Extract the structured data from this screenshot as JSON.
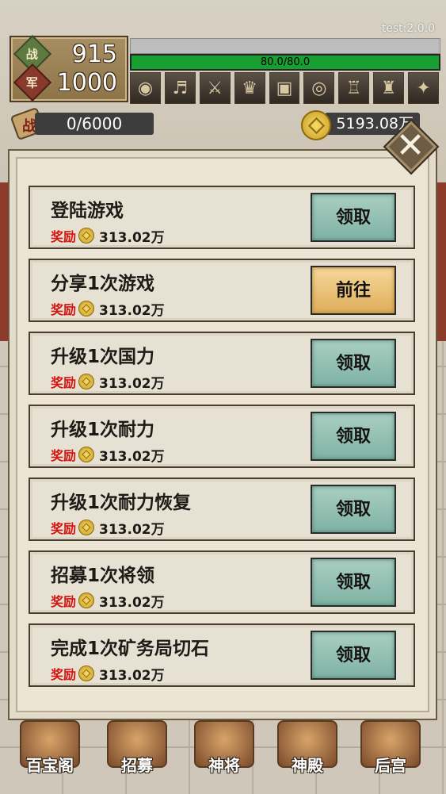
{
  "version_label": "test:2.0.0",
  "hud": {
    "stat1": {
      "icon_char": "战",
      "value": "915"
    },
    "stat2": {
      "icon_char": "军",
      "value": "1000"
    },
    "hp": {
      "text": "80.0/80.0",
      "fraction": 1.0
    },
    "equip_icons": [
      "orb-icon",
      "guitar-icon",
      "crossbow-icon",
      "golden-dragon-icon",
      "treasure-box-icon",
      "drum-icon",
      "chalice-icon",
      "golden-pagoda-icon",
      "sword-icon"
    ],
    "scroll_char": "战",
    "progress_text": "0/6000",
    "gold_text": "5193.08万"
  },
  "modal": {
    "close_label": "✕",
    "tasks": [
      {
        "title": "登陆游戏",
        "reward_label": "奖励",
        "amount": "313.02万",
        "button": "领取",
        "type": "claim"
      },
      {
        "title": "分享1次游戏",
        "reward_label": "奖励",
        "amount": "313.02万",
        "button": "前往",
        "type": "go"
      },
      {
        "title": "升级1次国力",
        "reward_label": "奖励",
        "amount": "313.02万",
        "button": "领取",
        "type": "claim"
      },
      {
        "title": "升级1次耐力",
        "reward_label": "奖励",
        "amount": "313.02万",
        "button": "领取",
        "type": "claim"
      },
      {
        "title": "升级1次耐力恢复",
        "reward_label": "奖励",
        "amount": "313.02万",
        "button": "领取",
        "type": "claim"
      },
      {
        "title": "招募1次将领",
        "reward_label": "奖励",
        "amount": "313.02万",
        "button": "领取",
        "type": "claim"
      },
      {
        "title": "完成1次矿务局切石",
        "reward_label": "奖励",
        "amount": "313.02万",
        "button": "领取",
        "type": "claim"
      }
    ]
  },
  "bottom_nav": [
    {
      "label": "百宝阁",
      "icon": "treasure-chest-icon"
    },
    {
      "label": "招募",
      "icon": "recruit-icon"
    },
    {
      "label": "神将",
      "icon": "general-icon"
    },
    {
      "label": "神殿",
      "icon": "temple-icon"
    },
    {
      "label": "后宫",
      "icon": "palace-lady-icon"
    }
  ]
}
